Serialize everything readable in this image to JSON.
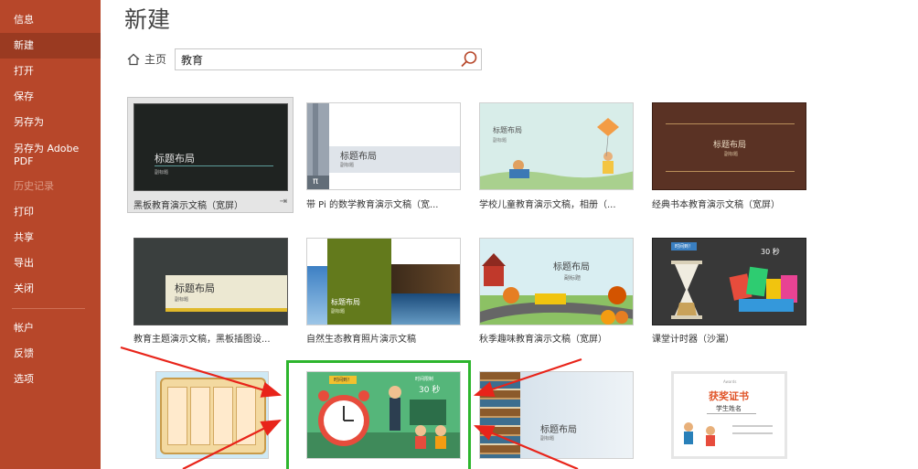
{
  "sidebar": {
    "items": [
      {
        "label": "信息"
      },
      {
        "label": "新建"
      },
      {
        "label": "打开"
      },
      {
        "label": "保存"
      },
      {
        "label": "另存为"
      },
      {
        "label": "另存为 Adobe PDF"
      },
      {
        "label": "历史记录"
      },
      {
        "label": "打印"
      },
      {
        "label": "共享"
      },
      {
        "label": "导出"
      },
      {
        "label": "关闭"
      },
      {
        "label": "帐户"
      },
      {
        "label": "反馈"
      },
      {
        "label": "选项"
      }
    ]
  },
  "main": {
    "title": "新建",
    "home_label": "主页",
    "search_value": "教育"
  },
  "templates": [
    {
      "label": "黑板教育演示文稿（宽屏）",
      "thumb_title": "标题布局",
      "thumb_subtitle": "副标题"
    },
    {
      "label": "带 Pi 的数学教育演示文稿（宽...",
      "thumb_title": "标题布局",
      "thumb_subtitle": "副标题",
      "thumb_symbol": "π"
    },
    {
      "label": "学校儿童教育演示文稿，相册（...",
      "thumb_title": "标题布局",
      "thumb_subtitle": "副标题"
    },
    {
      "label": "经典书本教育演示文稿（宽屏）",
      "thumb_title": "标题布局",
      "thumb_subtitle": "副标题"
    },
    {
      "label": "教育主题演示文稿，黑板插图设...",
      "thumb_title": "标题布局",
      "thumb_subtitle": "副标题"
    },
    {
      "label": "自然生态教育照片演示文稿",
      "thumb_title": "标题布局",
      "thumb_subtitle": "副标题"
    },
    {
      "label": "秋季趣味教育演示文稿（宽屏）",
      "thumb_title": "标题布局",
      "thumb_subtitle": "副标题"
    },
    {
      "label": "课堂计时器（沙漏）",
      "thumb_badge": "时间到！",
      "thumb_timer": "30 秒"
    },
    {
      "label": "",
      "thumb_title": ""
    },
    {
      "label": "",
      "thumb_badge": "时间到！",
      "thumb_small": "时间限制",
      "thumb_timer": "30 秒"
    },
    {
      "label": "",
      "thumb_title": "标题布局",
      "thumb_subtitle": "副标题"
    },
    {
      "label": "",
      "thumb_title": "获奖证书",
      "thumb_subtitle": "学生姓名",
      "thumb_small": "Awards"
    }
  ],
  "colors": {
    "sidebar_bg": "#b7472a",
    "sidebar_active": "#9a3a21",
    "highlight": "#2db52d",
    "arrow": "#e8241a"
  }
}
